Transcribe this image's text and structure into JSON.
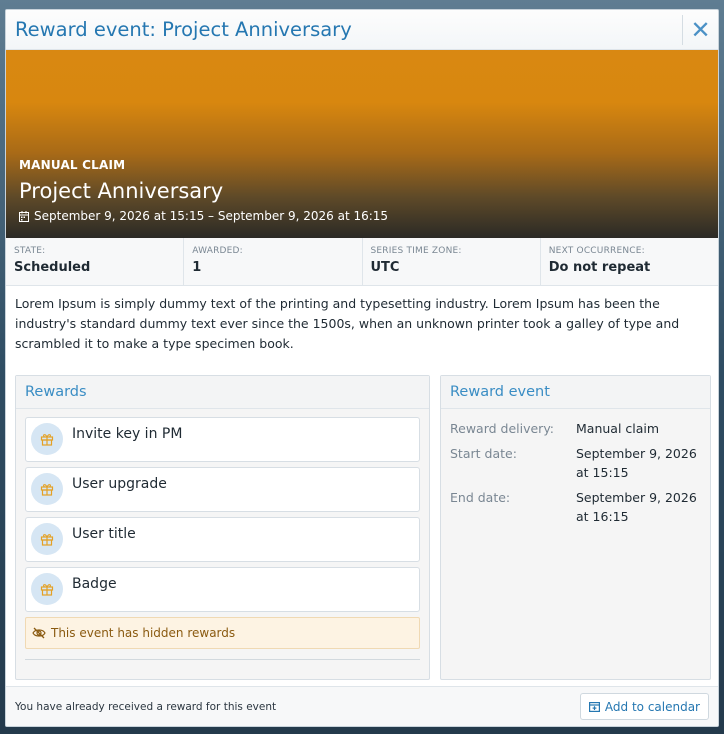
{
  "dialog": {
    "title": "Reward event: Project Anniversary",
    "close_icon": "close-icon"
  },
  "banner": {
    "tag": "MANUAL CLAIM",
    "title": "Project Anniversary",
    "dates": "September 9, 2026 at 15:15 – September 9, 2026 at 16:15",
    "gradient_top": "#d98812",
    "gradient_bottom": "#2b2a26"
  },
  "stats": [
    {
      "label": "State:",
      "value": "Scheduled"
    },
    {
      "label": "Awarded:",
      "value": "1"
    },
    {
      "label": "Series time zone:",
      "value": "UTC"
    },
    {
      "label": "Next occurrence:",
      "value": "Do not repeat"
    }
  ],
  "description": "Lorem Ipsum is simply dummy text of the printing and typesetting industry. Lorem Ipsum has been the industry's standard dummy text ever since the 1500s, when an unknown printer took a galley of type and scrambled it to make a type specimen book.",
  "rewards": {
    "heading": "Rewards",
    "items": [
      {
        "label": "Invite key in PM",
        "icon": "gift-icon"
      },
      {
        "label": "User upgrade",
        "icon": "gift-icon"
      },
      {
        "label": "User title",
        "icon": "gift-icon"
      },
      {
        "label": "Badge",
        "icon": "gift-icon"
      }
    ],
    "hidden_note": "This event has hidden rewards",
    "hidden_icon": "eye-slash-icon"
  },
  "reward_event": {
    "heading": "Reward event",
    "delivery_label": "Reward delivery:",
    "delivery_value": "Manual claim",
    "start_label": "Start date:",
    "start_value": "September 9, 2026 at 15:15",
    "end_label": "End date:",
    "end_value": "September 9, 2026 at 16:15"
  },
  "footer": {
    "text": "You have already received a reward for this event",
    "calendar_button": "Add to calendar"
  },
  "colors": {
    "accent": "#2577b1",
    "heading_blue": "#3a8dc4",
    "warning_bg": "#fdf3e3",
    "warning_text": "#8a5a10"
  }
}
